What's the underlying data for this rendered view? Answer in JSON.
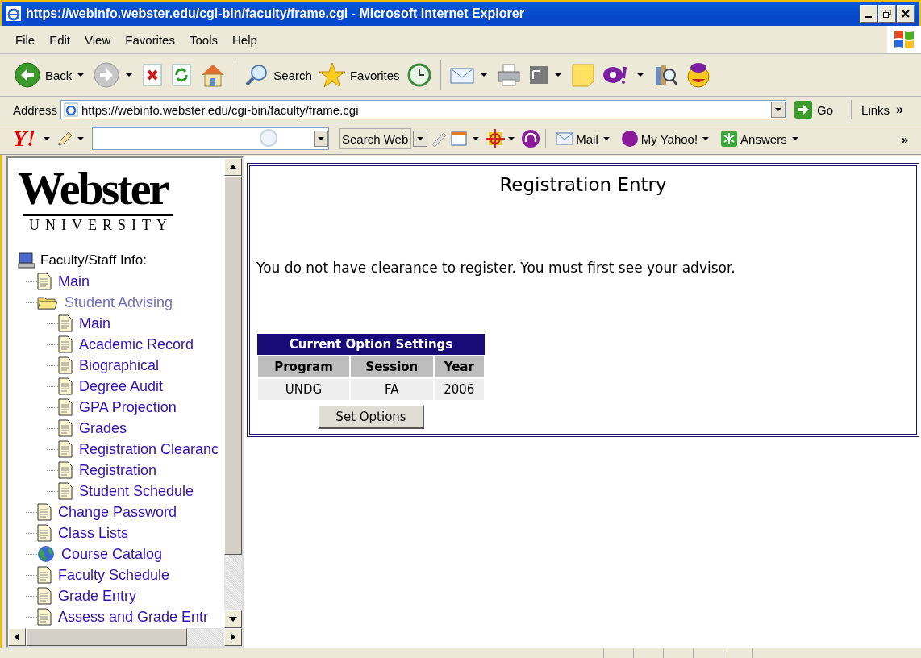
{
  "window": {
    "title": "https://webinfo.webster.edu/cgi-bin/faculty/frame.cgi - Microsoft Internet Explorer"
  },
  "menu": [
    "File",
    "Edit",
    "View",
    "Favorites",
    "Tools",
    "Help"
  ],
  "toolbar": [
    {
      "kind": "back",
      "label": "Back",
      "dropdown": true
    },
    {
      "kind": "forward",
      "dropdown": true
    },
    {
      "kind": "stop",
      "dropdown": false
    },
    {
      "kind": "refresh",
      "dropdown": false
    },
    {
      "kind": "home",
      "dropdown": false
    },
    {
      "kind": "search",
      "label": "Search",
      "dropdown": false
    },
    {
      "kind": "favorites",
      "label": "Favorites",
      "dropdown": false
    },
    {
      "kind": "history",
      "dropdown": false
    },
    {
      "kind": "mail",
      "dropdown": true
    },
    {
      "kind": "print",
      "dropdown": false
    },
    {
      "kind": "edit",
      "dropdown": true
    },
    {
      "kind": "note",
      "dropdown": false
    },
    {
      "kind": "yahoo",
      "dropdown": true
    },
    {
      "kind": "research",
      "dropdown": false
    },
    {
      "kind": "messenger",
      "dropdown": false
    }
  ],
  "address": {
    "label": "Address",
    "url": "https://webinfo.webster.edu/cgi-bin/faculty/frame.cgi",
    "go": "Go",
    "links": "Links",
    "more": "»"
  },
  "yahoo_bar": {
    "logo": "Y!",
    "search_button": "Search Web",
    "items": [
      {
        "kind": "mail",
        "label": "Mail"
      },
      {
        "kind": "myyahoo",
        "label": "My Yahoo!"
      },
      {
        "kind": "answers",
        "label": "Answers"
      }
    ],
    "more": "»"
  },
  "sidebar": {
    "logo": {
      "name": "Webster",
      "sub": "UNIVERSITY"
    },
    "root": {
      "label": "Faculty/Staff Info:",
      "children": [
        {
          "kind": "page",
          "label": "Main"
        },
        {
          "kind": "folder",
          "label": "Student Advising",
          "expanded": true,
          "children": [
            {
              "kind": "page",
              "label": "Main"
            },
            {
              "kind": "page",
              "label": "Academic Record"
            },
            {
              "kind": "page",
              "label": "Biographical"
            },
            {
              "kind": "page",
              "label": "Degree Audit"
            },
            {
              "kind": "page",
              "label": "GPA Projection"
            },
            {
              "kind": "page",
              "label": "Grades"
            },
            {
              "kind": "page",
              "label": "Registration Clearanc"
            },
            {
              "kind": "page",
              "label": "Registration"
            },
            {
              "kind": "page",
              "label": "Student Schedule"
            }
          ]
        },
        {
          "kind": "page",
          "label": "Change Password"
        },
        {
          "kind": "page",
          "label": "Class Lists"
        },
        {
          "kind": "globe",
          "label": "Course Catalog"
        },
        {
          "kind": "page",
          "label": "Faculty Schedule"
        },
        {
          "kind": "page",
          "label": "Grade Entry"
        },
        {
          "kind": "page",
          "label": "Assess and Grade Entr"
        }
      ]
    }
  },
  "main": {
    "heading": "Registration Entry",
    "message": "You do not have clearance to register. You must first see your advisor.",
    "table": {
      "title": "Current Option Settings",
      "columns": [
        "Program",
        "Session",
        "Year"
      ],
      "rows": [
        [
          "UNDG",
          "FA",
          "2006"
        ]
      ]
    },
    "button": "Set Options"
  }
}
